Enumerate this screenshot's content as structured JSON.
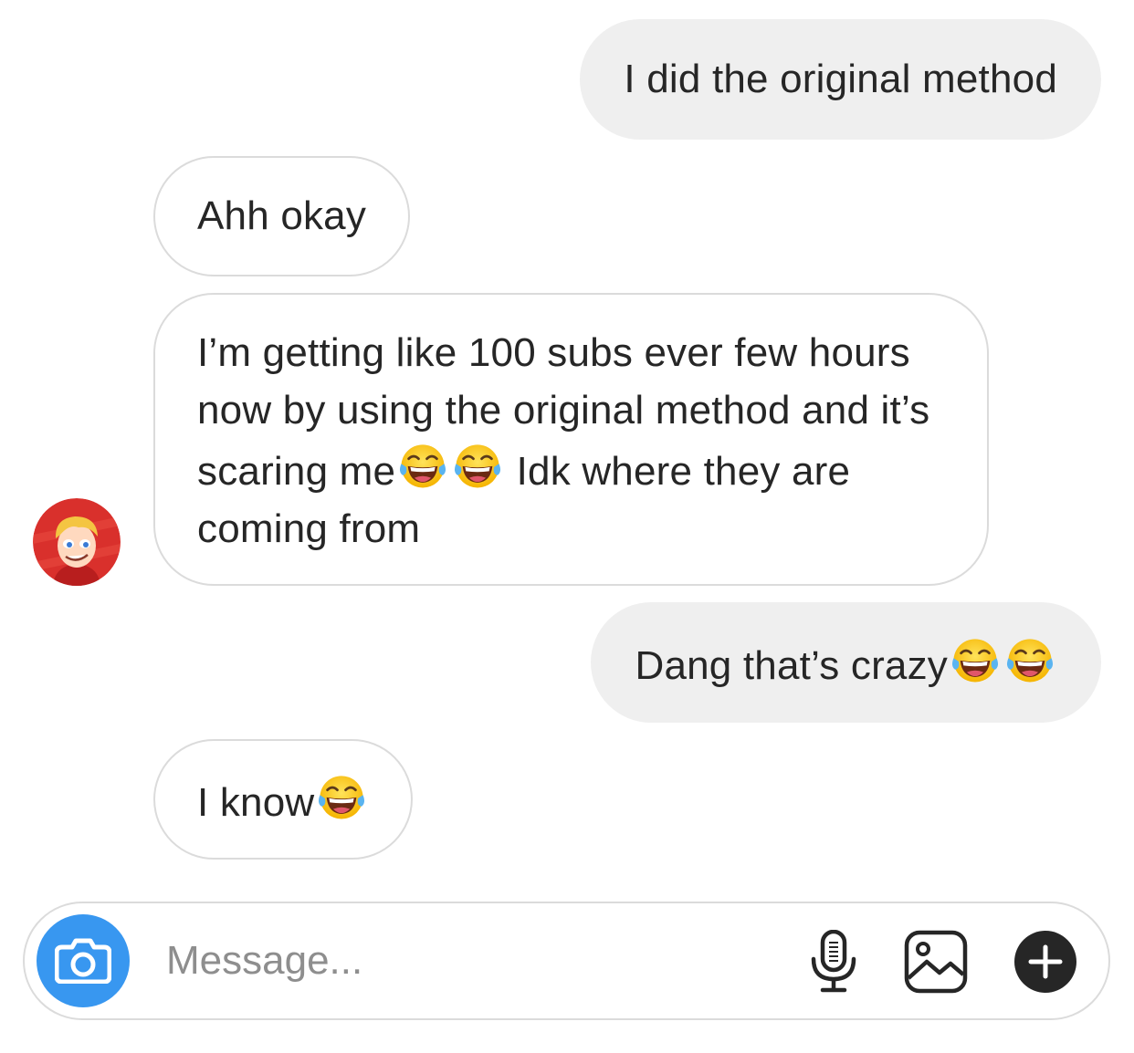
{
  "conversation": {
    "messages": [
      {
        "direction": "sent",
        "text": "I did the original method"
      },
      {
        "direction": "received",
        "text": "Ahh okay"
      },
      {
        "direction": "received",
        "parts": [
          "I’m getting like 100 subs ever few hours now by using the original method and it’s scaring me",
          " Idk where they are coming from"
        ]
      },
      {
        "direction": "sent",
        "text": "Dang that’s crazy"
      },
      {
        "direction": "received",
        "text": "I know"
      }
    ],
    "emoji_icon": "face-with-tears-of-joy-icon"
  },
  "composer": {
    "placeholder": "Message...",
    "value": "",
    "icons": [
      "camera-icon",
      "microphone-icon",
      "gallery-icon",
      "plus-icon"
    ]
  },
  "colors": {
    "sent_bubble": "#efefef",
    "received_border": "#dbdbdb",
    "camera_accent": "#3897f0",
    "text": "#262626",
    "placeholder": "#8e8e8e"
  }
}
